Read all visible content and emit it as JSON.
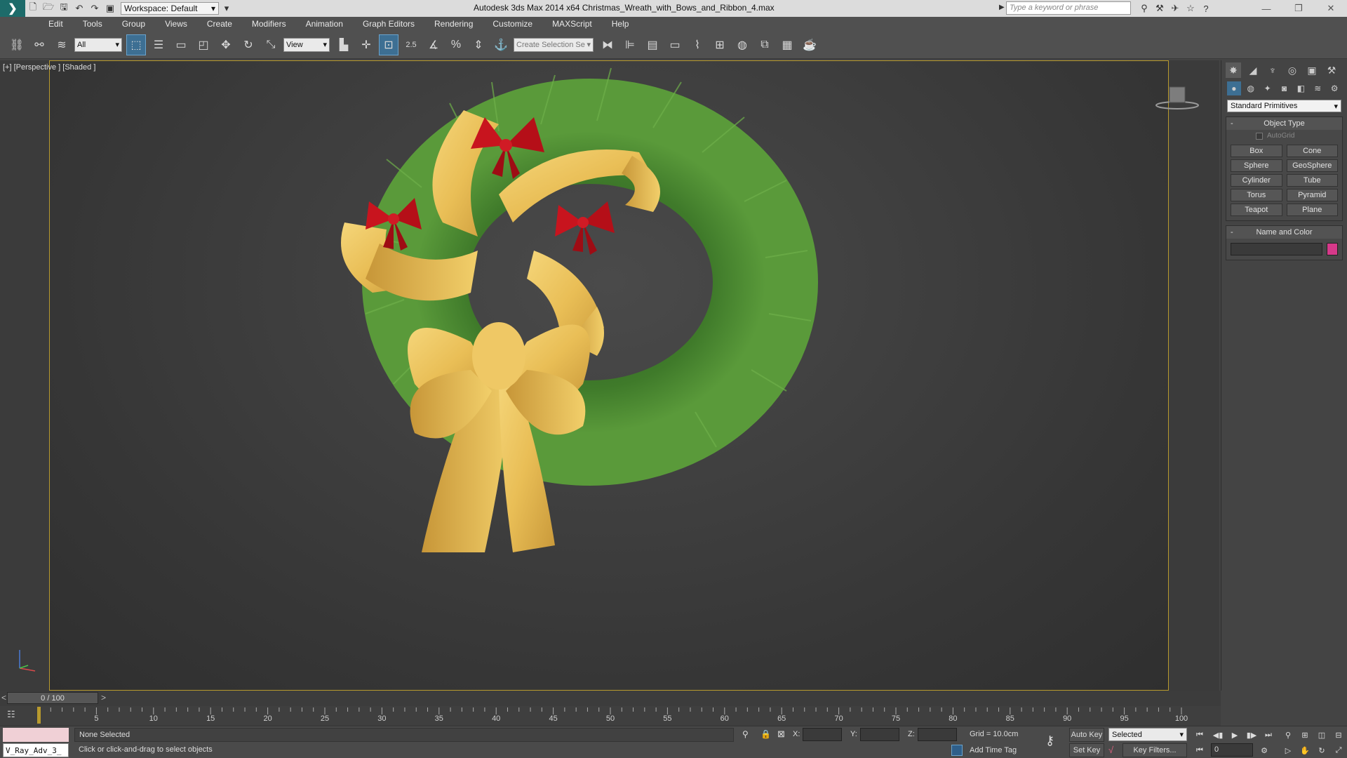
{
  "titlebar": {
    "workspace_label": "Workspace: Default",
    "title": "Autodesk 3ds Max  2014 x64      Christmas_Wreath_with_Bows_and_Ribbon_4.max",
    "search_placeholder": "Type a keyword or phrase"
  },
  "menu": [
    "Edit",
    "Tools",
    "Group",
    "Views",
    "Create",
    "Modifiers",
    "Animation",
    "Graph Editors",
    "Rendering",
    "Customize",
    "MAXScript",
    "Help"
  ],
  "toolbar": {
    "filter_value": "All",
    "refcoord_value": "View",
    "snap_label": "2.5",
    "selection_set_placeholder": "Create Selection Se"
  },
  "viewport": {
    "label": "[+] [Perspective ] [Shaded ]"
  },
  "command_panel": {
    "category_value": "Standard Primitives",
    "object_type_title": "Object Type",
    "autogrid_label": "AutoGrid",
    "primitives": [
      "Box",
      "Cone",
      "Sphere",
      "GeoSphere",
      "Cylinder",
      "Tube",
      "Torus",
      "Pyramid",
      "Teapot",
      "Plane"
    ],
    "name_color_title": "Name and Color",
    "color": "#d6398a"
  },
  "timeline": {
    "frame_readout": "0 / 100",
    "ticks": [
      "5",
      "10",
      "15",
      "20",
      "25",
      "30",
      "35",
      "40",
      "45",
      "50",
      "55",
      "60",
      "65",
      "70",
      "75",
      "80",
      "85",
      "90",
      "95",
      "100"
    ]
  },
  "status": {
    "maxscript_text": "V_Ray_Adv_3_",
    "selection": "None Selected",
    "prompt": "Click or click-and-drag to select objects",
    "x_label": "X:",
    "y_label": "Y:",
    "z_label": "Z:",
    "grid": "Grid = 10.0cm",
    "add_time_tag": "Add Time Tag",
    "auto_key": "Auto Key",
    "set_key": "Set Key",
    "selected_value": "Selected",
    "key_filters": "Key Filters...",
    "frame_value": "0"
  }
}
